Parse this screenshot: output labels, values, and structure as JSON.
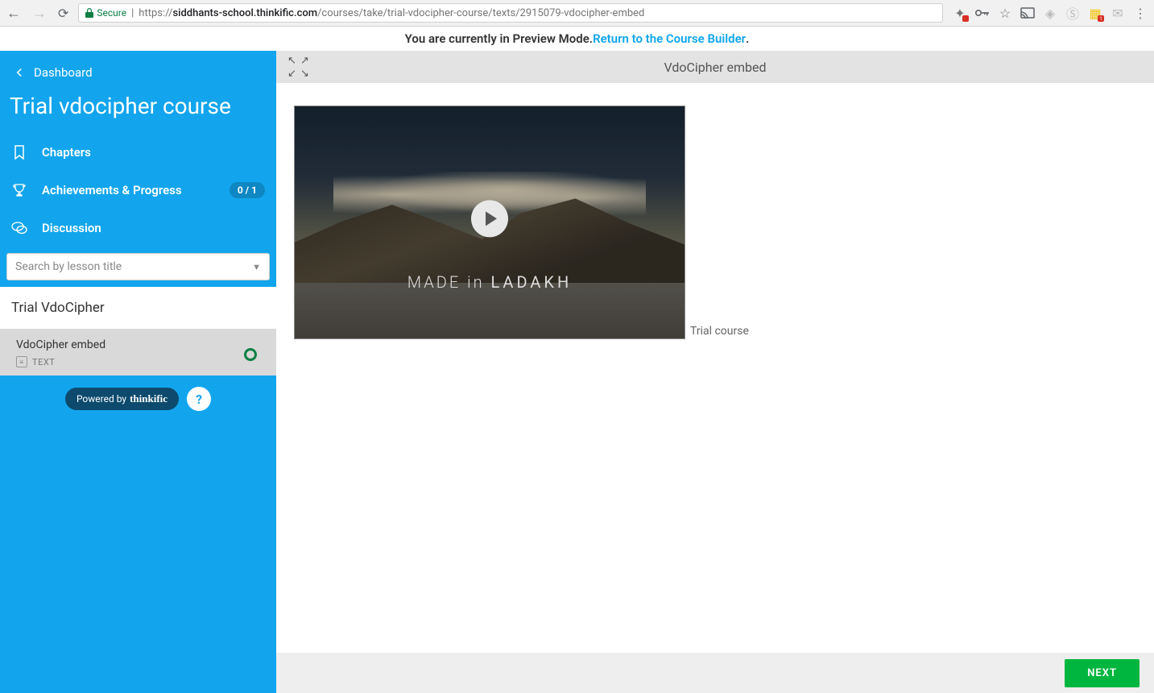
{
  "browser": {
    "secure_label": "Secure",
    "url_prefix": "https://",
    "url_host": "siddhants-school.thinkific.com",
    "url_path": "/courses/take/trial-vdocipher-course/texts/2915079-vdocipher-embed"
  },
  "preview": {
    "text": "You are currently in Preview Mode. ",
    "link": "Return to the Course Builder",
    "suffix": "."
  },
  "sidebar": {
    "dashboard": "Dashboard",
    "course_title": "Trial vdocipher course",
    "chapters": "Chapters",
    "achievements": "Achievements & Progress",
    "progress": "0 / 1",
    "discussion": "Discussion",
    "search_placeholder": "Search by lesson title",
    "chapter_name": "Trial VdoCipher",
    "lesson_title": "VdoCipher embed",
    "lesson_type": "TEXT",
    "powered_by": "Powered by",
    "brand": "thinkific",
    "help": "?"
  },
  "content": {
    "title": "VdoCipher embed",
    "video_text_a": "MADE in ",
    "video_text_b": "LADAKH",
    "trial_label": "Trial course"
  },
  "footer": {
    "next": "NEXT"
  }
}
